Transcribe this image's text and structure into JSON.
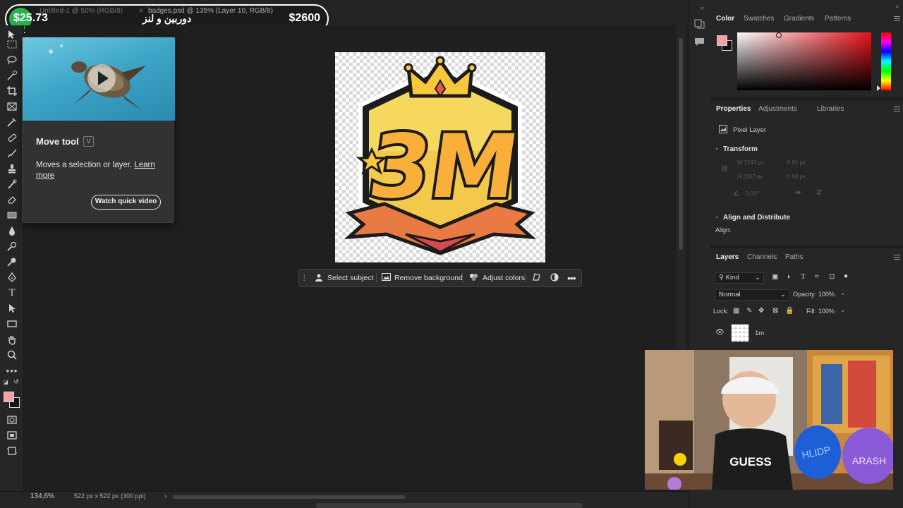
{
  "tabs": {
    "doc1": "Untitled-1 @ 50% (RGB/8)",
    "doc2": "badges.psd @ 135% (Layer 10, RGB/8)"
  },
  "price_overlay": {
    "left": "$25.73",
    "middle": "دوربین و لنز",
    "right": "$2600"
  },
  "tooltip": {
    "title": "Move tool",
    "shortcut": "V",
    "description": "Moves a selection or layer.",
    "learn_more": "Learn more",
    "button": "Watch quick video"
  },
  "canvas": {
    "badge_text": "3M"
  },
  "contextual_taskbar": {
    "select_subject": "Select subject",
    "remove_background": "Remove background",
    "adjust_colors": "Adjust colors"
  },
  "status": {
    "zoom": "134,6%",
    "doc_info": "522 px x 522 px (300 ppi)"
  },
  "color_panel": {
    "tabs": [
      "Color",
      "Swatches",
      "Gradients",
      "Patterns"
    ],
    "foreground": "#f4a0a6",
    "background": "#111111"
  },
  "properties_panel": {
    "tabs": [
      "Properties",
      "Adjustments",
      "Libraries"
    ],
    "layer_type": "Pixel Layer",
    "transform_title": "Transform",
    "w": "W  2243 px",
    "x": "X  91 px",
    "h": "H  2067 px",
    "y": "Y  98 px",
    "angle": "0.00°",
    "align_title": "Align and Distribute",
    "align_label": "Align:"
  },
  "layers_panel": {
    "tabs": [
      "Layers",
      "Channels",
      "Paths"
    ],
    "filter": "Kind",
    "blend_mode": "Normal",
    "opacity_label": "Opacity:",
    "opacity": "100%",
    "lock_label": "Lock:",
    "fill_label": "Fill:",
    "fill": "100%",
    "layer_name": "1m"
  },
  "webcam": {
    "shirt_text": "GUESS",
    "balloon_left": "HLIDP",
    "balloon_right": "ARASH"
  }
}
